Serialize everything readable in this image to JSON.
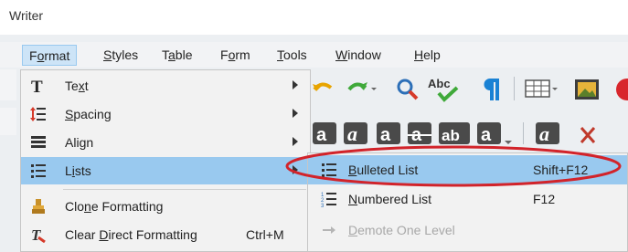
{
  "window": {
    "title": "Writer"
  },
  "menubar": {
    "items": [
      {
        "label_pre": "F",
        "label_mn": "o",
        "label_post": "rmat"
      },
      {
        "label_pre": "",
        "label_mn": "S",
        "label_post": "tyles"
      },
      {
        "label_pre": "T",
        "label_mn": "a",
        "label_post": "ble"
      },
      {
        "label_pre": "F",
        "label_mn": "o",
        "label_post": "rm"
      },
      {
        "label_pre": "",
        "label_mn": "T",
        "label_post": "ools"
      },
      {
        "label_pre": "",
        "label_mn": "W",
        "label_post": "indow"
      },
      {
        "label_pre": "",
        "label_mn": "H",
        "label_post": "elp"
      }
    ]
  },
  "format_menu": {
    "items": [
      {
        "label_pre": "Te",
        "label_mn": "x",
        "label_post": "t",
        "icon": "text-icon"
      },
      {
        "label_pre": "",
        "label_mn": "S",
        "label_post": "pacing",
        "icon": "spacing-icon"
      },
      {
        "label_pre": "Ali",
        "label_mn": "g",
        "label_post": "n",
        "icon": "align-icon"
      },
      {
        "label_pre": "L",
        "label_mn": "i",
        "label_post": "sts",
        "icon": "lists-icon"
      },
      {
        "label_pre": "Clo",
        "label_mn": "n",
        "label_post": "e Formatting",
        "icon": "clone-formatting-icon"
      },
      {
        "label_pre": "Clear ",
        "label_mn": "D",
        "label_post": "irect Formatting",
        "accel": "Ctrl+M",
        "icon": "clear-formatting-icon"
      }
    ]
  },
  "lists_submenu": {
    "items": [
      {
        "label_pre": "",
        "label_mn": "B",
        "label_post": "ulleted List",
        "accel": "Shift+F12"
      },
      {
        "label_pre": "",
        "label_mn": "N",
        "label_post": "umbered List",
        "accel": "F12"
      },
      {
        "label_pre": "",
        "label_mn": "D",
        "label_post": "emote One Level",
        "accel": ""
      }
    ]
  },
  "toolbar": {
    "spellcheck_glyph": "Abc",
    "style_glyphs": [
      "a",
      "a",
      "a",
      "a",
      "ab",
      "a",
      "a"
    ]
  },
  "colors": {
    "menu_highlight": "#99c9ef",
    "active_menu_bg": "#cde4f7",
    "annotation_ellipse": "#d2232a",
    "pilcrow": "#1a82d4"
  }
}
